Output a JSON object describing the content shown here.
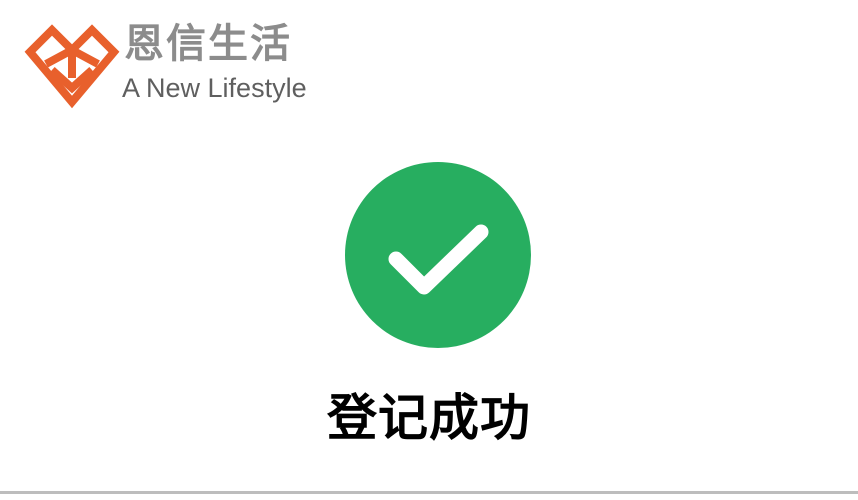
{
  "logo": {
    "icon": "enxin-diamond-logo-icon",
    "name_cn": "恩信生活",
    "tagline": "A New Lifestyle",
    "brand_color": "#e8602c",
    "text_color": "#8c8c8c"
  },
  "result": {
    "icon": "check-circle-icon",
    "icon_color": "#27ae60",
    "message": "登记成功"
  }
}
